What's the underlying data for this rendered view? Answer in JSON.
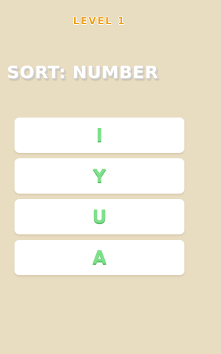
{
  "header": {
    "level_label": "LEVEL 1",
    "sort_label": "SORT: NUMBER"
  },
  "cards": [
    {
      "letter": "I"
    },
    {
      "letter": "Y"
    },
    {
      "letter": "U"
    },
    {
      "letter": "A"
    }
  ],
  "colors": {
    "background": "#E8DCC1",
    "level_text": "#F0A21E",
    "card_background": "#FFFFFF",
    "letter_green": "#7EE08A"
  }
}
